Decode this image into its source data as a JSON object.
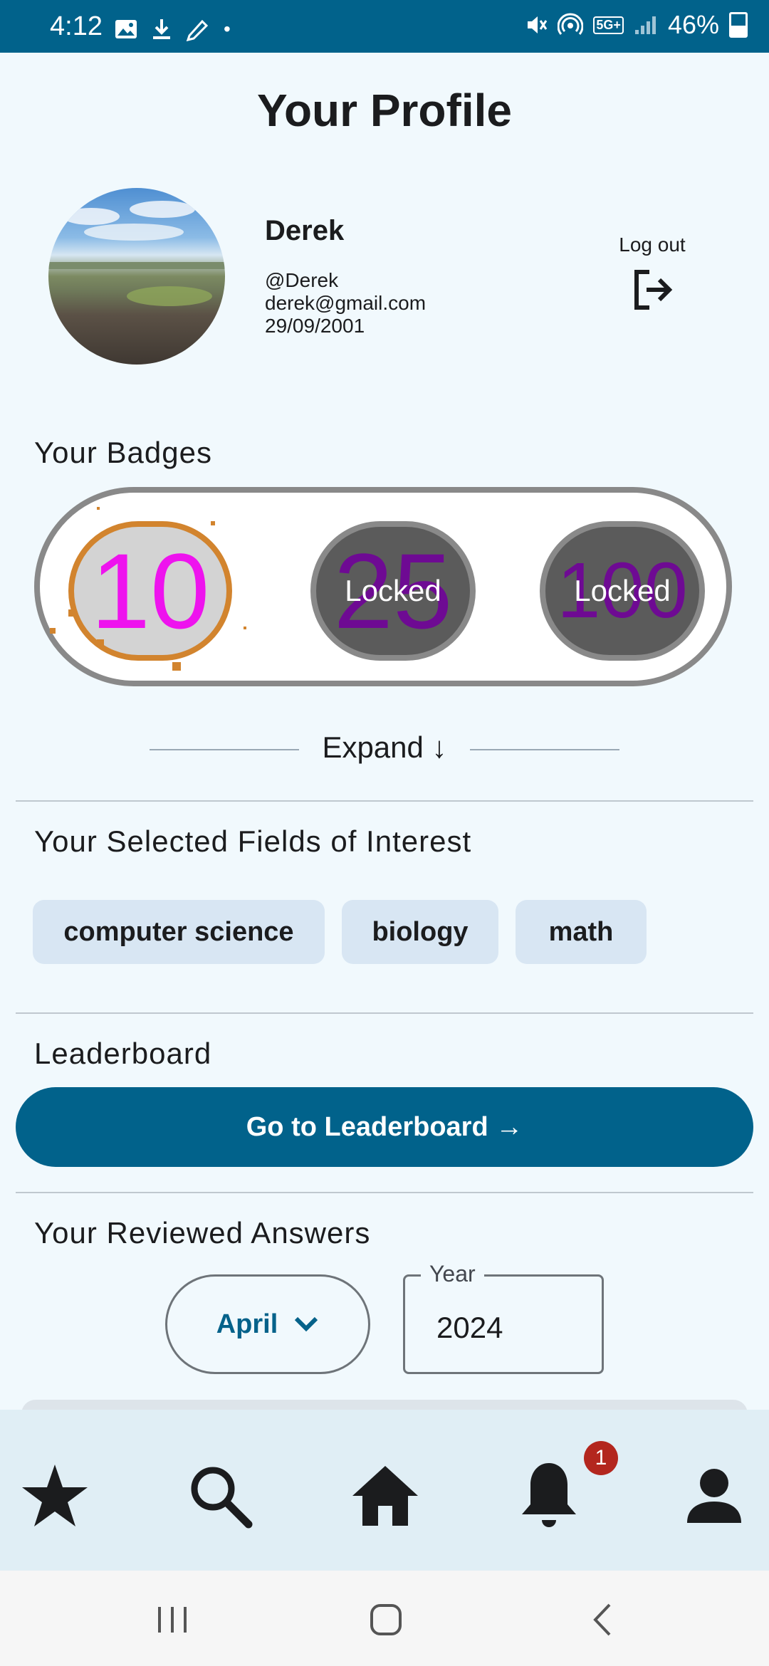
{
  "status_bar": {
    "time": "4:12",
    "battery": "46%",
    "network": "5G+"
  },
  "title": "Your Profile",
  "profile": {
    "name": "Derek",
    "handle": "@Derek",
    "email": "derek@gmail.com",
    "birthdate": "29/09/2001",
    "logout_label": "Log out"
  },
  "badges": {
    "heading": "Your Badges",
    "items": [
      {
        "value": "10",
        "status": ""
      },
      {
        "value": "25",
        "status": "Locked"
      },
      {
        "value": "100",
        "status": "Locked"
      }
    ],
    "expand_label": "Expand ↓"
  },
  "interests": {
    "heading": "Your Selected Fields of Interest",
    "chips": [
      "computer science",
      "biology",
      "math"
    ]
  },
  "leaderboard": {
    "heading": "Leaderboard",
    "button_label": "Go to Leaderboard →"
  },
  "reviewed": {
    "heading": "Your Reviewed Answers",
    "month": "April",
    "year_label": "Year",
    "year": "2024"
  },
  "bottom_nav": {
    "items": [
      "star-icon",
      "search-icon",
      "home-icon",
      "bell-icon",
      "person-icon"
    ],
    "notification_count": "1"
  },
  "colors": {
    "primary": "#01628b",
    "background": "#f1f9fd",
    "chip": "#d8e6f3",
    "badge_number": "#ee13ee",
    "badge_ring": "#d2842e",
    "notification": "#b3261e"
  }
}
